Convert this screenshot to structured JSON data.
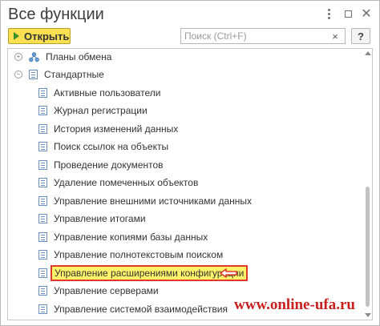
{
  "window": {
    "title": "Все функции"
  },
  "toolbar": {
    "open_label": "Открыть",
    "help_label": "?"
  },
  "search": {
    "placeholder": "Поиск (Ctrl+F)",
    "value": "",
    "clear_label": "×"
  },
  "tree": {
    "group_exchange": {
      "label": "Планы обмена",
      "toggle": "+"
    },
    "group_standard": {
      "label": "Стандартные",
      "toggle": "−"
    },
    "items": [
      {
        "label": "Активные пользователи"
      },
      {
        "label": "Журнал регистрации"
      },
      {
        "label": "История изменений данных"
      },
      {
        "label": "Поиск ссылок на объекты"
      },
      {
        "label": "Проведение документов"
      },
      {
        "label": "Удаление помеченных объектов"
      },
      {
        "label": "Управление внешними источниками данных"
      },
      {
        "label": "Управление итогами"
      },
      {
        "label": "Управление копиями базы данных"
      },
      {
        "label": "Управление полнотекстовым поиском"
      },
      {
        "label": "Управление расширениями конфигурации",
        "highlighted": true
      },
      {
        "label": "Управление серверами"
      },
      {
        "label": "Управление системой взаимодействия"
      }
    ]
  },
  "watermark": "www.online-ufa.ru",
  "colors": {
    "highlight_fill": "#fff36a",
    "highlight_border": "#e0392c",
    "open_button": "#fbe052",
    "watermark": "#c8201e"
  }
}
